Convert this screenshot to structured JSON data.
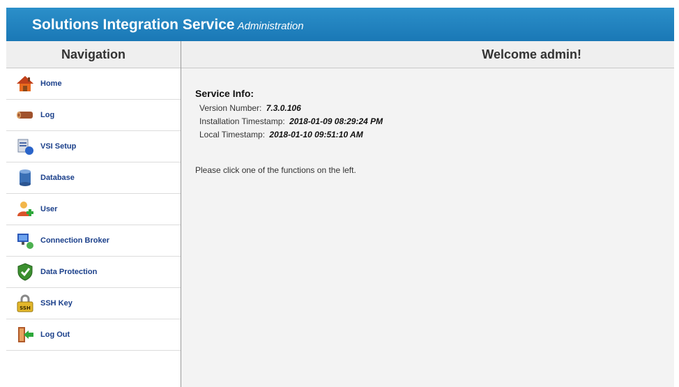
{
  "header": {
    "title": "Solutions Integration Service",
    "subtitle": "Administration"
  },
  "nav": {
    "title": "Navigation",
    "items": [
      {
        "label": "Home",
        "icon": "home-icon"
      },
      {
        "label": "Log",
        "icon": "log-icon"
      },
      {
        "label": "VSI Setup",
        "icon": "vsi-setup-icon"
      },
      {
        "label": "Database",
        "icon": "database-icon"
      },
      {
        "label": "User",
        "icon": "user-icon"
      },
      {
        "label": "Connection Broker",
        "icon": "connection-broker-icon"
      },
      {
        "label": "Data Protection",
        "icon": "shield-icon"
      },
      {
        "label": "SSH Key",
        "icon": "ssh-key-icon"
      },
      {
        "label": "Log Out",
        "icon": "logout-icon"
      }
    ]
  },
  "main": {
    "welcome": "Welcome admin!",
    "service_info_title": "Service Info:",
    "version_label": "Version Number:",
    "version_value": "7.3.0.106",
    "install_label": "Installation Timestamp:",
    "install_value": "2018-01-09 08:29:24 PM",
    "local_label": "Local Timestamp:",
    "local_value": "2018-01-10 09:51:10 AM",
    "hint": "Please click one of the functions on the left."
  }
}
